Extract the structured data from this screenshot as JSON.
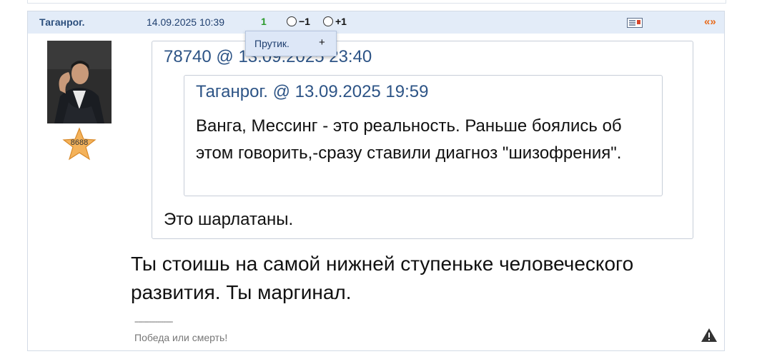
{
  "post": {
    "author": "Таганрог.",
    "date": "14.09.2025 10:39",
    "score": "1",
    "vote_minus": "−1",
    "vote_plus": "+1",
    "quote_button": "«»",
    "tooltip": {
      "name": "Прутик.",
      "plus": "+"
    },
    "rating": "8688",
    "quote": {
      "header": "78740 @ 13.09.2025 23:40",
      "nested": {
        "header": "Таганрог. @ 13.09.2025 19:59",
        "text": "Ванга, Мессинг - это реальность. Раньше боялись об этом говорить,-сразу ставили диагноз \"шизофрения\"."
      },
      "text": "Это шарлатаны."
    },
    "message": "Ты стоишь на самой нижней ступеньке человеческого развития. Ты маргинал.",
    "signature_separator": "--------------------",
    "signature": "Победа или смерть!"
  },
  "colors": {
    "header_bg": "#e3ecf8",
    "author": "#2c4f7d",
    "score": "#2b9a2b",
    "quote_icon": "#e86b1c",
    "quote_header": "#2d5486"
  },
  "icons": [
    "radio-minus-icon",
    "radio-plus-icon",
    "card-icon",
    "quote-icon",
    "star-icon",
    "warning-icon"
  ]
}
